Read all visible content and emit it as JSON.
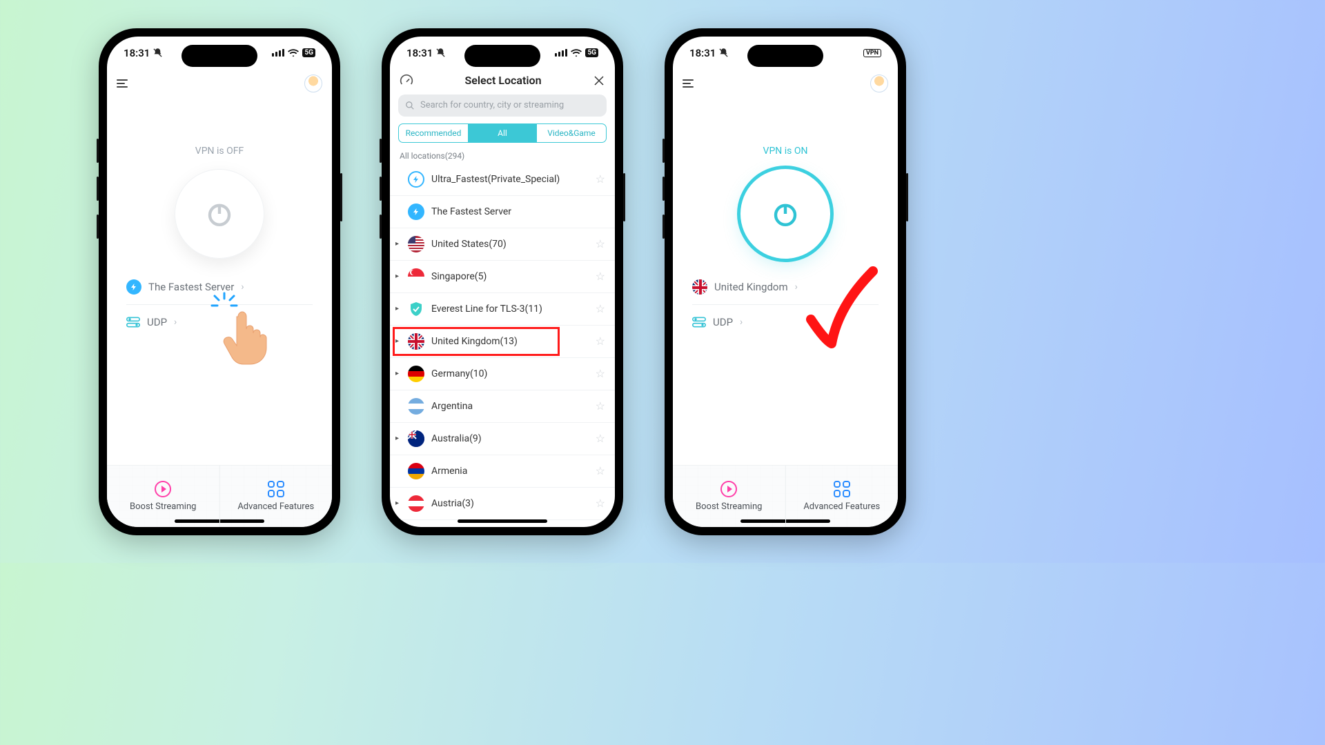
{
  "status": {
    "time": "18:31"
  },
  "screen1": {
    "vpn_state": "VPN is OFF",
    "server_label": "The Fastest Server",
    "protocol": "UDP",
    "bottom": {
      "boost": "Boost Streaming",
      "adv": "Advanced Features"
    }
  },
  "screen2": {
    "title": "Select Location",
    "search_placeholder": "Search for country, city or streaming",
    "tabs": {
      "rec": "Recommended",
      "all": "All",
      "vg": "Video&Game"
    },
    "list_header": "All locations(294)",
    "items": {
      "ultra": "Ultra_Fastest(Private_Special)",
      "fast": "The Fastest Server",
      "us": "United States(70)",
      "sg": "Singapore(5)",
      "ev": "Everest Line for TLS-3(11)",
      "uk": "United Kingdom(13)",
      "de": "Germany(10)",
      "ar": "Argentina",
      "au": "Australia(9)",
      "am": "Armenia",
      "at": "Austria(3)"
    }
  },
  "screen3": {
    "vpn_state": "VPN is ON",
    "server_label": "United Kingdom",
    "protocol": "UDP",
    "bottom": {
      "boost": "Boost Streaming",
      "adv": "Advanced Features"
    }
  }
}
